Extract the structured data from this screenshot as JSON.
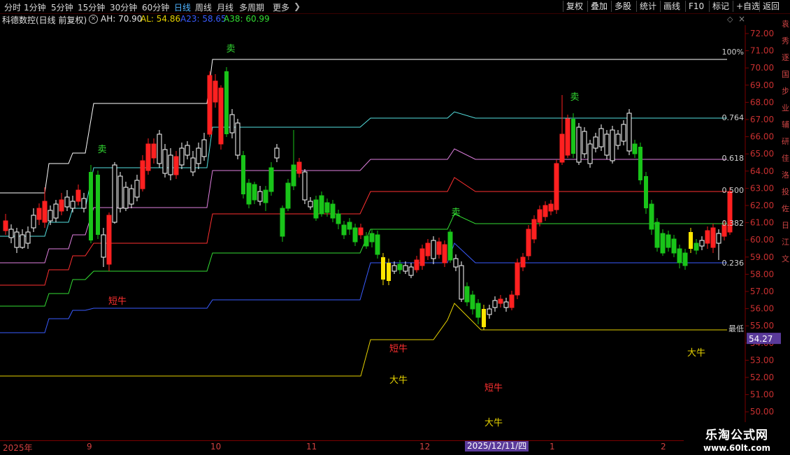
{
  "toolbar": {
    "periods": [
      "分时",
      "1分钟",
      "5分钟",
      "15分钟",
      "30分钟",
      "60分钟",
      "日线",
      "周线",
      "月线",
      "多周期",
      "更多"
    ],
    "active_period": "日线",
    "right_buttons": [
      "复权",
      "叠加",
      "多股",
      "统计",
      "画线",
      "F10",
      "标记",
      "+自选",
      "返回"
    ]
  },
  "info": {
    "title": "科德数控(日线 前复权)",
    "settings_icon": "circle-x-icon",
    "ah_label": "AH: 70.90",
    "al_label": "AL: 54.86",
    "a23_label": "A23: 58.65",
    "a38_label": "A38: 60.99",
    "colors": {
      "ah": "#e0e0e0",
      "al": "#e6d200",
      "a23": "#3a5cff",
      "a38": "#33dd33"
    }
  },
  "axis": {
    "ticks": [
      "72.00",
      "71.00",
      "70.00",
      "69.00",
      "68.00",
      "67.00",
      "66.00",
      "65.00",
      "64.00",
      "63.00",
      "62.00",
      "61.00",
      "60.00",
      "59.00",
      "58.00",
      "57.00",
      "56.00",
      "55.00",
      "54.00",
      "53.00",
      "52.00",
      "51.00",
      "50.00"
    ],
    "current_price": "54.27",
    "current_price_color": "#5a3a9a"
  },
  "levels": [
    {
      "label": "100%",
      "color": "#ffffff"
    },
    {
      "label": "0.764",
      "color": "#55e0e0"
    },
    {
      "label": "0.618",
      "color": "#e080e0"
    },
    {
      "label": "0.500",
      "color": "#ff3030"
    },
    {
      "label": "0.382",
      "color": "#33dd33"
    },
    {
      "label": "0.236",
      "color": "#3a5cff"
    },
    {
      "label": "最低",
      "color": "#e6d200"
    }
  ],
  "annotations": [
    {
      "text": "卖",
      "color": "#33dd33"
    },
    {
      "text": "卖",
      "color": "#33dd33"
    },
    {
      "text": "卖",
      "color": "#33dd33"
    },
    {
      "text": "卖",
      "color": "#33dd33"
    },
    {
      "text": "短牛",
      "color": "#ff3030"
    },
    {
      "text": "短牛",
      "color": "#ff3030"
    },
    {
      "text": "短牛",
      "color": "#ff3030"
    },
    {
      "text": "大牛",
      "color": "#e6d200"
    },
    {
      "text": "大牛",
      "color": "#e6d200"
    },
    {
      "text": "大牛",
      "color": "#e6d200"
    }
  ],
  "dates": [
    "2025年",
    "9",
    "10",
    "11",
    "12",
    "1",
    "2"
  ],
  "date_highlight": "2025/12/11/四",
  "watermark": {
    "line1": "乐淘公式网",
    "line2": "www.60lt.com"
  },
  "right_strip_chars": [
    "袁",
    "秀",
    "逐",
    "国",
    "步",
    "业",
    "辅",
    "研",
    "佳",
    "洛",
    "投",
    "佐",
    "日",
    "江",
    "文"
  ]
}
